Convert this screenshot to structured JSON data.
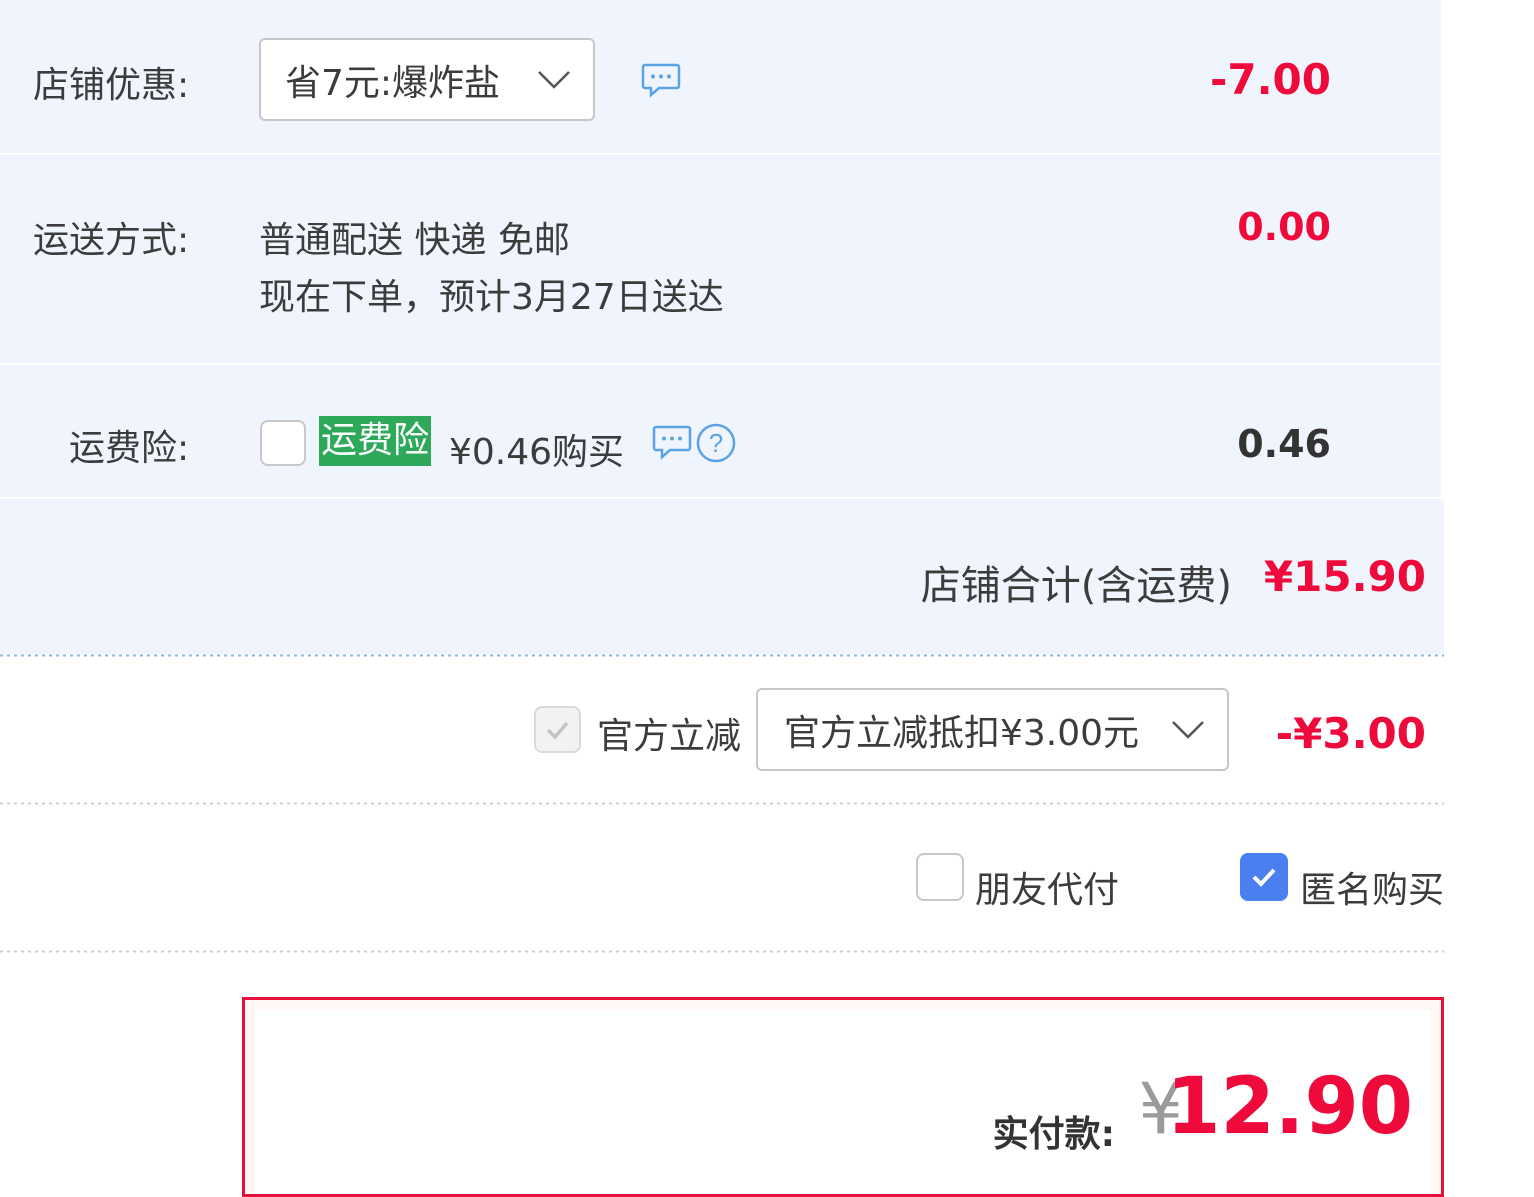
{
  "shop_discount": {
    "label": "店铺优惠:",
    "selected": "省7元:爆炸盐",
    "amount": "-7.00"
  },
  "shipping": {
    "label": "运送方式:",
    "method": "普通配送 快递 免邮",
    "eta": "现在下单，预计3月27日送达",
    "amount": "0.00"
  },
  "freight_insurance": {
    "label": "运费险:",
    "badge": "运费险",
    "price_text": "¥0.46购买",
    "amount": "0.46",
    "checked": false
  },
  "shop_total": {
    "label": "店铺合计(含运费)",
    "amount": "¥15.90"
  },
  "official_discount": {
    "checkbox_label": "官方立减",
    "selected": "官方立减抵扣¥3.00元",
    "amount": "-¥3.00",
    "checked": true,
    "disabled": true
  },
  "options": {
    "friend_pay_label": "朋友代付",
    "friend_pay_checked": false,
    "anonymous_label": "匿名购买",
    "anonymous_checked": true
  },
  "payment": {
    "label": "实付款:",
    "currency": "¥",
    "amount": "12.90"
  },
  "colors": {
    "accent_red": "#ee0a3b",
    "row_bg": "#f0f5fd",
    "checkbox_blue": "#4a7ff0",
    "badge_green": "#2ea95a",
    "icon_blue": "#5aa3e6"
  },
  "icons": [
    "chat-bubble-icon",
    "help-question-icon",
    "chevron-down-icon",
    "checkmark-icon"
  ]
}
